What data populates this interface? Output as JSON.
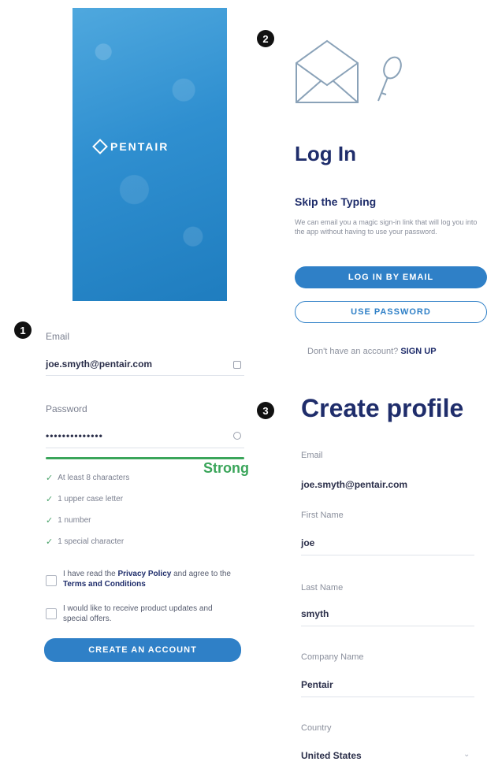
{
  "badges": {
    "one": "1",
    "two": "2",
    "three": "3"
  },
  "splash": {
    "brand": "PENTAIR"
  },
  "signup_form": {
    "email_label": "Email",
    "email_value": "joe.smyth@pentair.com",
    "password_label": "Password",
    "password_value": "••••••••••••••",
    "strength_label": "Strong",
    "rules": [
      "At least 8 characters",
      "1 upper case letter",
      "1 number",
      "1 special character"
    ],
    "agree_terms_pre": "I have read the ",
    "agree_terms_privacy": "Privacy Policy",
    "agree_terms_mid": " and agree to the ",
    "agree_terms_tc": "Terms and Conditions",
    "agree_offers": "I would like to receive product updates and special offers.",
    "create_button": "CREATE AN ACCOUNT"
  },
  "login": {
    "title": "Log In",
    "skip_title": "Skip the Typing",
    "skip_body": "We can email you a magic sign-in link that will log you into the app without having to use your password.",
    "email_button": "LOG IN BY EMAIL",
    "password_button": "USE PASSWORD",
    "no_account": "Don't have an account?",
    "signup": "SIGN UP"
  },
  "profile": {
    "title": "Create profile",
    "fields": [
      {
        "label": "Email",
        "value": "joe.smyth@pentair.com"
      },
      {
        "label": "First Name",
        "value": "joe"
      },
      {
        "label": "Last Name",
        "value": "smyth"
      },
      {
        "label": "Company Name",
        "value": "Pentair"
      },
      {
        "label": "Country",
        "value": "United States"
      }
    ]
  },
  "icons": [
    "envelope-icon",
    "key-icon",
    "eye-icon",
    "check-icon",
    "chevron-down-icon"
  ],
  "colors": {
    "brand_blue": "#2f80c7",
    "navy": "#1f2d6b",
    "success": "#3aa55a"
  }
}
